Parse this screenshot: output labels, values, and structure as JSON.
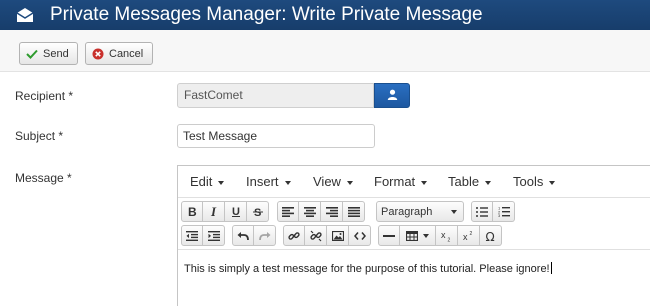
{
  "header": {
    "title": "Private Messages Manager: Write Private Message",
    "icon": "envelope-icon"
  },
  "toolbar": {
    "send_label": "Send",
    "cancel_label": "Cancel"
  },
  "form": {
    "recipient": {
      "label": "Recipient *",
      "value": "FastComet"
    },
    "subject": {
      "label": "Subject *",
      "value": "Test Message"
    },
    "message": {
      "label": "Message *"
    }
  },
  "editor": {
    "menus": [
      "Edit",
      "Insert",
      "View",
      "Format",
      "Table",
      "Tools"
    ],
    "format_select": "Paragraph",
    "content": "This is simply a test message for the purpose of this tutorial. Please ignore!"
  },
  "colors": {
    "header_bg": "#1e4a7e",
    "accent_blue": "#2a6fc1",
    "send_check": "#2e9b2e",
    "cancel_x": "#c9302c"
  }
}
